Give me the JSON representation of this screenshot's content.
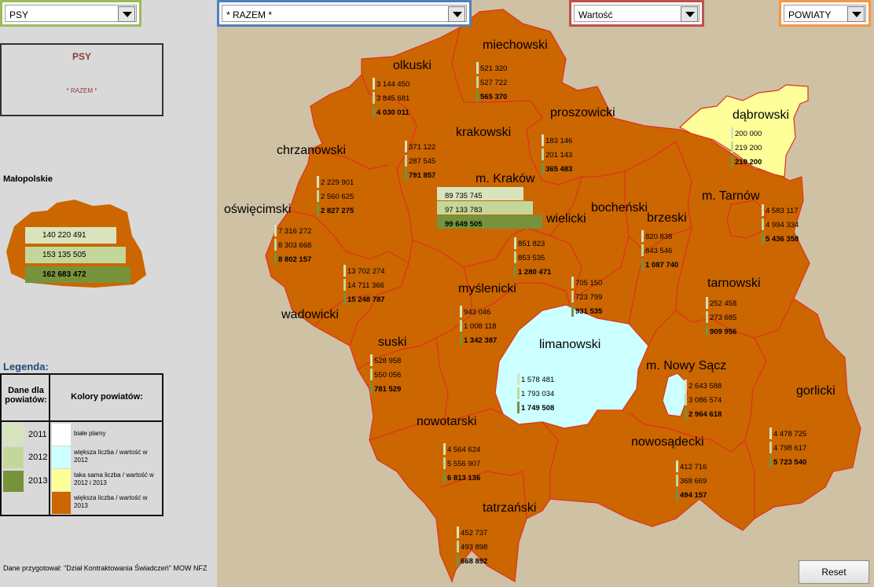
{
  "controls": {
    "category": "PSY",
    "region": "* RAZEM *",
    "measure": "Wartość",
    "level": "POWIATY",
    "reset_label": "Reset"
  },
  "selection": {
    "line1": "PSY",
    "line2": "* RAZEM *"
  },
  "region_summary": {
    "title": "Małopolskie",
    "values": [
      "140 220 491",
      "153 135 505",
      "162 683 472"
    ]
  },
  "legend": {
    "title": "Legenda:",
    "col1_header": "Dane dla powiatów:",
    "col2_header": "Kolory powiatów:",
    "years": [
      "2011",
      "2012",
      "2013"
    ],
    "year_colors": [
      "#d8e4bc",
      "#c4d79b",
      "#76933c"
    ],
    "items": [
      {
        "label": "białe plamy",
        "color": "#ffffff"
      },
      {
        "label": "większa liczba / wartość w 2012",
        "color": "#ccffff"
      },
      {
        "label": "taka sama liczba / wartość w 2012 i 2013",
        "color": "#ffff99"
      },
      {
        "label": "większa liczba / wartość w 2013",
        "color": "#cc6600"
      }
    ]
  },
  "credit": "Dane przygotował: \"Dział Kontraktowania Świadczeń\" MOW NFZ",
  "map": {
    "districts": [
      {
        "name": "miechowski",
        "values": [
          "521 320",
          "527 722",
          "565 370"
        ]
      },
      {
        "name": "olkuski",
        "values": [
          "3 144 450",
          "3 845 681",
          "4 030 011"
        ]
      },
      {
        "name": "proszowicki",
        "values": [
          "183 146",
          "201 143",
          "365 483"
        ]
      },
      {
        "name": "dąbrowski",
        "values": [
          "200 000",
          "219 200",
          "219 200"
        ]
      },
      {
        "name": "krakowski",
        "values": [
          "371 122",
          "287 545",
          "791 857"
        ]
      },
      {
        "name": "chrzanowski",
        "values": [
          "2 229 901",
          "2 560 625",
          "2 827 275"
        ]
      },
      {
        "name": "m. Kraków",
        "values": [
          "89 735 745",
          "97 133 783",
          "99 649 505"
        ]
      },
      {
        "name": "oświęcimski",
        "values": [
          "7 316 272",
          "8 303 668",
          "8 802 157"
        ]
      },
      {
        "name": "wielicki",
        "values": [
          "851 823",
          "853 535",
          "1 280 471"
        ]
      },
      {
        "name": "bocheński",
        "values": [
          "705 150",
          "723 799",
          "931 535"
        ]
      },
      {
        "name": "brzeski",
        "values": [
          "820 838",
          "843 546",
          "1 087 740"
        ]
      },
      {
        "name": "m. Tarnów",
        "values": [
          "4 583 117",
          "4 994 334",
          "5 436 358"
        ]
      },
      {
        "name": "tarnowski",
        "values": [
          "252 458",
          "273 685",
          "909 956"
        ]
      },
      {
        "name": "wadowicki",
        "values": [
          "13 702 274",
          "14 711 366",
          "15 248 787"
        ]
      },
      {
        "name": "myślenicki",
        "values": [
          "943 046",
          "1 008 118",
          "1 342 387"
        ]
      },
      {
        "name": "suski",
        "values": [
          "528 958",
          "550 056",
          "781 529"
        ]
      },
      {
        "name": "limanowski",
        "values": [
          "1 578 481",
          "1 793 034",
          "1 749 508"
        ]
      },
      {
        "name": "m. Nowy Sącz",
        "values": [
          "2 643 588",
          "3 086 574",
          "2 964 618"
        ]
      },
      {
        "name": "gorlicki",
        "values": [
          "4 478 725",
          "4 798 617",
          "5 723 540"
        ]
      },
      {
        "name": "nowotarski",
        "values": [
          "4 564 624",
          "5 556 907",
          "6 813 136"
        ]
      },
      {
        "name": "nowosądecki",
        "values": [
          "412 716",
          "368 669",
          "494 157"
        ]
      },
      {
        "name": "tatrzański",
        "values": [
          "452 737",
          "493 898",
          "668 892"
        ]
      }
    ]
  }
}
